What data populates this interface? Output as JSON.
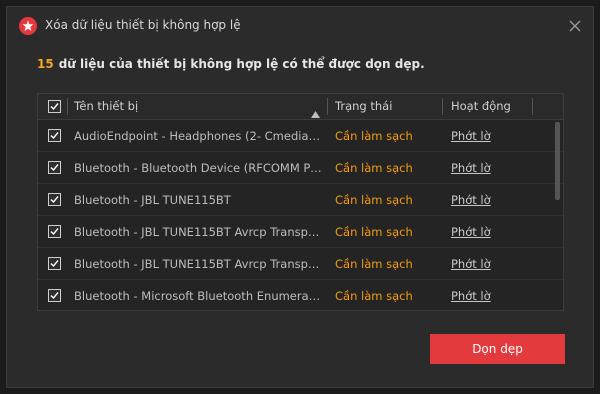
{
  "dialog": {
    "title": "Xóa dữ liệu thiết bị không hợp lệ",
    "summary_count": "15",
    "summary_text": "dữ liệu của thiết bị không hợp lệ có thể được dọn dẹp.",
    "icons": {
      "app": "app-logo-icon",
      "close": "close-icon"
    }
  },
  "table": {
    "columns": {
      "name": "Tên thiết bị",
      "status": "Trạng thái",
      "action": "Hoạt động"
    },
    "select_all_checked": true,
    "sort_icon": "sort-ascending-icon",
    "rows": [
      {
        "checked": true,
        "name": "AudioEndpoint - Headphones (2- Cmedia Aud...",
        "status": "Cần làm sạch",
        "action": "Phớt lờ"
      },
      {
        "checked": true,
        "name": "Bluetooth - Bluetooth Device (RFCOMM Proto...",
        "status": "Cần làm sạch",
        "action": "Phớt lờ"
      },
      {
        "checked": true,
        "name": "Bluetooth - JBL TUNE115BT",
        "status": "Cần làm sạch",
        "action": "Phớt lờ"
      },
      {
        "checked": true,
        "name": "Bluetooth - JBL TUNE115BT Avrcp Transport",
        "status": "Cần làm sạch",
        "action": "Phớt lờ"
      },
      {
        "checked": true,
        "name": "Bluetooth - JBL TUNE115BT Avrcp Transport",
        "status": "Cần làm sạch",
        "action": "Phớt lờ"
      },
      {
        "checked": true,
        "name": "Bluetooth - Microsoft Bluetooth Enumerator",
        "status": "Cần làm sạch",
        "action": "Phớt lờ"
      }
    ]
  },
  "footer": {
    "clean_button": "Dọn dẹp"
  },
  "colors": {
    "accent": "#e33a3e",
    "status": "#f39c12",
    "count": "#f7a51c"
  }
}
